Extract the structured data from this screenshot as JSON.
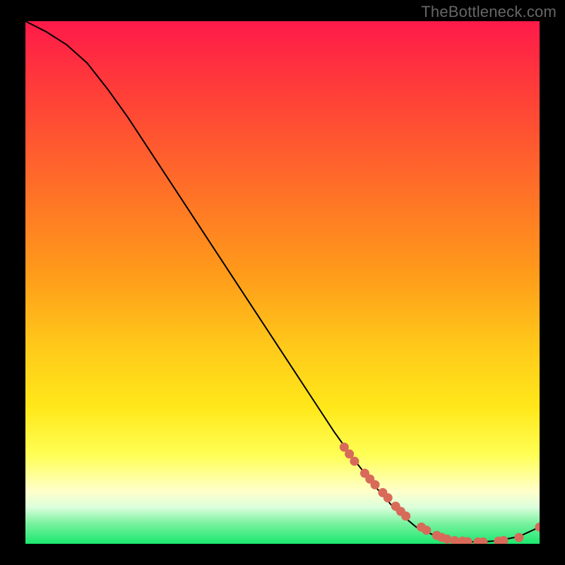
{
  "watermark": "TheBottleneck.com",
  "colors": {
    "bg": "#000000",
    "gradient_top": "#ff1a4a",
    "gradient_mid": "#ffd200",
    "gradient_low": "#ffff88",
    "gradient_green": "#1ae86f",
    "curve": "#000000",
    "dot": "#d86a5a"
  },
  "chart_data": {
    "type": "line",
    "title": "",
    "xlabel": "",
    "ylabel": "",
    "xlim": [
      0,
      100
    ],
    "ylim": [
      0,
      100
    ],
    "series": [
      {
        "name": "curve",
        "x": [
          0,
          4,
          8,
          12,
          16,
          20,
          24,
          28,
          32,
          36,
          40,
          44,
          48,
          52,
          56,
          60,
          64,
          68,
          72,
          76,
          80,
          84,
          88,
          92,
          96,
          100
        ],
        "y": [
          100,
          98,
          95.5,
          92,
          87,
          81.5,
          75.5,
          69.5,
          63.5,
          57.5,
          51.5,
          45.5,
          39.5,
          33.5,
          27.5,
          21.5,
          16,
          11,
          6.5,
          3.2,
          1.4,
          0.6,
          0.3,
          0.6,
          1.4,
          3.2
        ]
      },
      {
        "name": "dots",
        "x": [
          62,
          63,
          64,
          66,
          67,
          68,
          69.5,
          70.5,
          72,
          73,
          74,
          77,
          78,
          80,
          81,
          82,
          83.5,
          85,
          86,
          88,
          89,
          92,
          93,
          96,
          100
        ],
        "y": [
          18.5,
          17.2,
          15.8,
          13.5,
          12.4,
          11.3,
          9.8,
          8.8,
          7.2,
          6.2,
          5.3,
          3.2,
          2.6,
          1.6,
          1.2,
          0.9,
          0.6,
          0.5,
          0.4,
          0.35,
          0.35,
          0.5,
          0.6,
          1.2,
          3.2
        ]
      }
    ]
  }
}
